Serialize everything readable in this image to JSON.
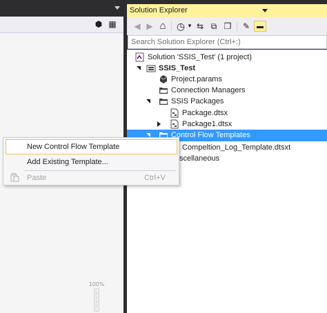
{
  "solution_explorer": {
    "title": "Solution Explorer",
    "search_placeholder": "Search Solution Explorer (Ctrl+;)",
    "toolbar": [
      {
        "icon": "back-icon",
        "glyph": "◀",
        "disabled": true
      },
      {
        "icon": "forward-icon",
        "glyph": "▶",
        "disabled": true
      },
      {
        "icon": "home-icon",
        "glyph": "⌂",
        "disabled": false
      },
      {
        "icon": "history-icon",
        "glyph": "◷",
        "disabled": false
      },
      {
        "icon": "sync-icon",
        "glyph": "⇆",
        "disabled": false
      },
      {
        "icon": "collapse-all-icon",
        "glyph": "⧉",
        "disabled": false
      },
      {
        "icon": "show-all-files-icon",
        "glyph": "❐",
        "disabled": false
      },
      {
        "icon": "properties-wrench-icon",
        "glyph": "✎",
        "disabled": false
      },
      {
        "icon": "preview-toggle-icon",
        "glyph": "▬",
        "disabled": false
      }
    ],
    "tree": {
      "solution": "Solution 'SSIS_Test' (1 project)",
      "project": "SSIS_Test",
      "project_params": "Project.params",
      "connection_managers": "Connection Managers",
      "ssis_packages": "SSIS Packages",
      "package_1": "Package.dtsx",
      "package_2": "Package1.dtsx",
      "control_flow_templates": "Control Flow Templates",
      "template_file": "Compeltion_Log_Template.dtsxt",
      "miscellaneous": "scellaneous"
    }
  },
  "context_menu": {
    "items": [
      {
        "label": "New Control Flow Template",
        "shortcut": "",
        "disabled": false,
        "hover": true
      },
      {
        "label": "Add Existing Template...",
        "shortcut": "",
        "disabled": false,
        "hover": false
      },
      {
        "label": "Paste",
        "shortcut": "Ctrl+V",
        "disabled": true,
        "hover": false
      }
    ]
  },
  "designer": {
    "zoom_label": "100%"
  },
  "colors": {
    "frame_dark": "#2d2d30",
    "active_title": "#fff29d",
    "selection": "#3399ff",
    "menu_background": "#f6f6f6"
  }
}
